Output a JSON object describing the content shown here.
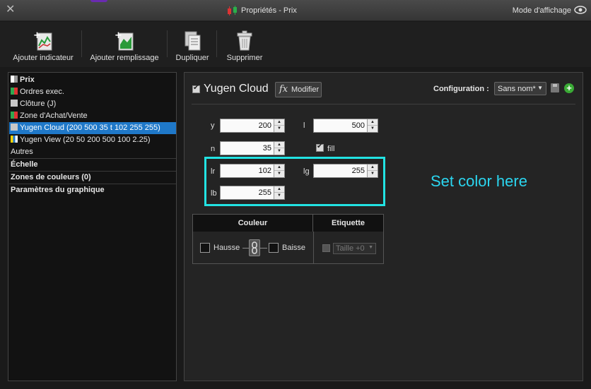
{
  "window": {
    "title": "Propriétés - Prix",
    "display_mode": "Mode d'affichage"
  },
  "toolbar": {
    "add_indicator": "Ajouter indicateur",
    "add_fill": "Ajouter remplissage",
    "duplicate": "Dupliquer",
    "delete": "Supprimer"
  },
  "list": {
    "items": [
      {
        "label": "Prix",
        "color": "#ffffff"
      },
      {
        "label": "Ordres exec.",
        "color": "#2fa84f"
      },
      {
        "label": "Clôture (J)",
        "color": "#c8c8c8"
      },
      {
        "label": "Zone d'Achat/Vente",
        "color": "#2fa84f"
      },
      {
        "label": "Yugen Cloud (200 500 35 t 102 255 255)",
        "color": "#c8c8c8"
      },
      {
        "label": "Yugen View (20 50 200 500 100 2.25)",
        "color": "#ffd400"
      },
      {
        "label": "Autres"
      }
    ],
    "sections": [
      "Échelle",
      "Zones de couleurs (0)",
      "Paramètres du graphique"
    ]
  },
  "indicator": {
    "name": "Yugen Cloud",
    "modify": "Modifier",
    "fx": "fx",
    "config_label": "Configuration :",
    "config_value": "Sans nom*",
    "params": {
      "y_label": "y",
      "y": "200",
      "l_label": "l",
      "l": "500",
      "n_label": "n",
      "n": "35",
      "fill_label": "fill",
      "lr_label": "lr",
      "lr": "102",
      "lg_label": "lg",
      "lg": "255",
      "lb_label": "lb",
      "lb": "255"
    },
    "annotation": "Set color here"
  },
  "color_table": {
    "couleur": "Couleur",
    "etiquette": "Etiquette",
    "hausse": "Hausse",
    "baisse": "Baisse",
    "label_value": "Taille +0"
  }
}
